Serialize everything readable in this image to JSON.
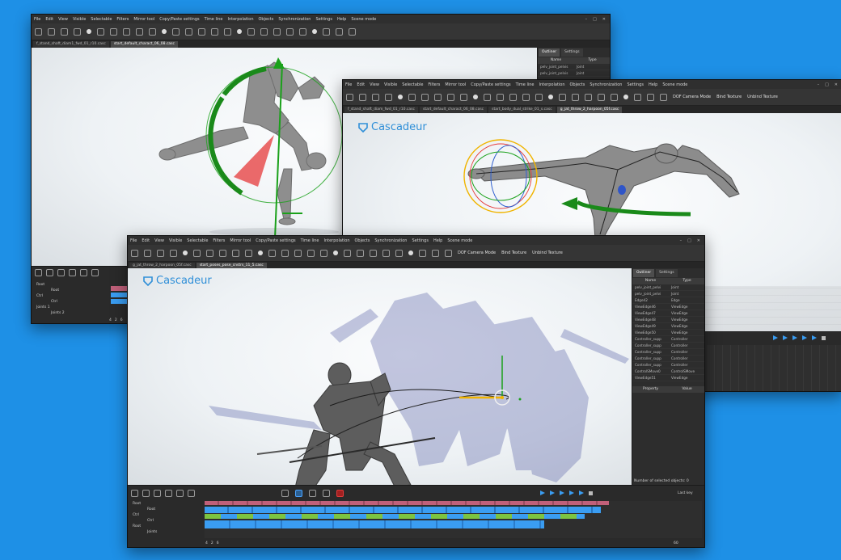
{
  "brand": {
    "logo_text": "Cascadeur"
  },
  "colors": {
    "background": "#1e90e6",
    "accent": "#3a9df2",
    "gizmo_green": "#1aa11a",
    "gizmo_red": "#e53a3a"
  },
  "windows": {
    "w1": {
      "menu": [
        "File",
        "Edit",
        "View",
        "Visible",
        "Selectable",
        "Filters",
        "Mirror tool",
        "Copy/Paste settings",
        "Time line",
        "Interpolation",
        "Objects",
        "Synchronization",
        "Settings",
        "Help",
        "Scene mode"
      ],
      "tabs": [
        "f_stand_shaft_diam1_fwd_01_r10.casc",
        "start_default_charact_06_08.casc"
      ],
      "side_tabs": [
        "Outliner",
        "Settings"
      ],
      "columns": [
        "Name",
        "Type"
      ],
      "rows": [
        [
          "pelv_joint_pelvis",
          "Joint"
        ],
        [
          "pelv_joint_pelvis",
          "Joint"
        ]
      ],
      "tracks": [
        "Root",
        "Root",
        "Ctrl",
        "Ctrl",
        "Joints 1",
        "Joints 2"
      ],
      "page": [
        "4",
        "2",
        "6"
      ]
    },
    "w2": {
      "menu": [
        "File",
        "Edit",
        "View",
        "Visible",
        "Selectable",
        "Filters",
        "Mirror tool",
        "Copy/Paste settings",
        "Time line",
        "Interpolation",
        "Objects",
        "Synchronization",
        "Settings",
        "Help",
        "Scene mode"
      ],
      "toolbar_text": [
        "DOF Camera Mode",
        "Bind Texture",
        "Unbind Texture"
      ],
      "tabs": [
        "f_stand_shaft_diam_fwd_01_r10.casc",
        "start_default_charact_06_08.casc",
        "start_body_dual_strike_01_s.casc",
        "g_jat_throw_2_harpoon_05f.casc"
      ]
    },
    "w3": {
      "menu": [
        "File",
        "Edit",
        "View",
        "Visible",
        "Selectable",
        "Filters",
        "Mirror tool",
        "Copy/Paste settings",
        "Time line",
        "Interpolation",
        "Objects",
        "Synchronization",
        "Settings",
        "Help",
        "Scene mode"
      ],
      "toolbar_text": [
        "DOF Camera Mode",
        "Bind Texture",
        "Unbind Texture"
      ],
      "tabs": [
        "g_jat_throw_2_harpoon_05f.casc",
        "start_poses_pose_cnstrs_11_5.casc"
      ],
      "side_tabs": [
        "Outliner",
        "Settings"
      ],
      "columns": [
        "Name",
        "Type"
      ],
      "rows": [
        [
          "pelv_joint_pelvi",
          "Joint"
        ],
        [
          "pelv_joint_pelvi",
          "Joint"
        ],
        [
          "Edge42",
          "Edge"
        ],
        [
          "ViewEdge46",
          "ViewEdge"
        ],
        [
          "ViewEdge47",
          "ViewEdge"
        ],
        [
          "ViewEdge48",
          "ViewEdge"
        ],
        [
          "ViewEdge49",
          "ViewEdge"
        ],
        [
          "ViewEdge50",
          "ViewEdge"
        ],
        [
          "Controller_supp",
          "Controller"
        ],
        [
          "Controller_supp",
          "Controller"
        ],
        [
          "Controller_supp",
          "Controller"
        ],
        [
          "Controller_supp",
          "Controller"
        ],
        [
          "Controller_supp",
          "Controller"
        ],
        [
          "ControlSMove0",
          "ControlSMove"
        ],
        [
          "ViewEdge51",
          "ViewEdge"
        ]
      ],
      "prop_columns": [
        "Property",
        "Value"
      ],
      "status": "Number of selected objects: 0",
      "tracks": [
        "Root",
        "Root",
        "Ctrl",
        "Ctrl",
        "Root",
        "Joints"
      ],
      "page": [
        "4",
        "2",
        "6"
      ],
      "frame": "60",
      "fps_label": "Last key"
    }
  }
}
